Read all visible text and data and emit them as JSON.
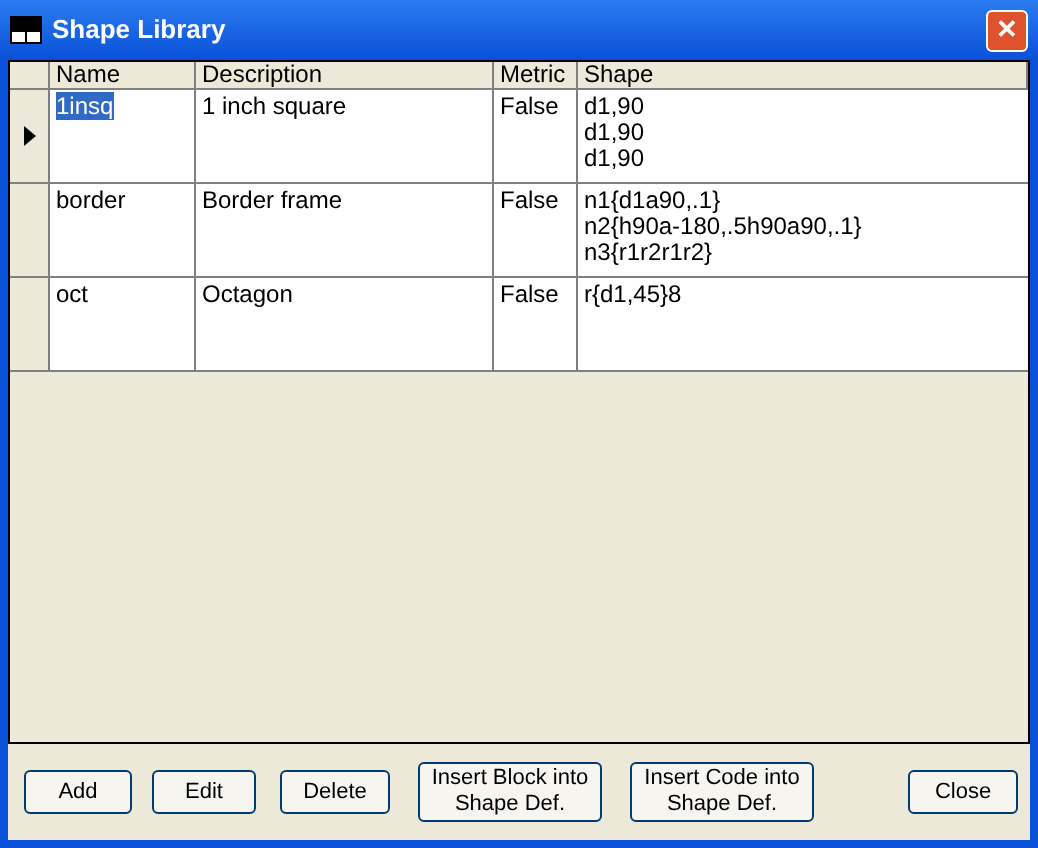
{
  "window": {
    "title": "Shape Library",
    "close": "✕"
  },
  "table": {
    "columns": [
      "Name",
      "Description",
      "Metric",
      "Shape"
    ],
    "rows": [
      {
        "selected": true,
        "cells": [
          "1insq",
          "1 inch square",
          "False"
        ],
        "shape": [
          "d1,90",
          "d1,90",
          "d1,90"
        ]
      },
      {
        "selected": false,
        "cells": [
          "border",
          "Border frame",
          "False"
        ],
        "shape": [
          "n1{d1a90,.1}",
          "n2{h90a-180,.5h90a90,.1}",
          "n3{r1r2r1r2}"
        ]
      },
      {
        "selected": false,
        "cells": [
          "oct",
          "Octagon",
          "False"
        ],
        "shape": [
          "r{d1,45}8"
        ]
      }
    ]
  },
  "buttons": [
    {
      "lines": [
        "Add"
      ]
    },
    {
      "lines": [
        "Edit"
      ]
    },
    {
      "lines": [
        "Delete"
      ]
    },
    {
      "lines": [
        "Insert Block into",
        "Shape Def."
      ]
    },
    {
      "lines": [
        "Insert Code into",
        "Shape Def."
      ]
    },
    {
      "lines": [
        "Close"
      ]
    }
  ]
}
